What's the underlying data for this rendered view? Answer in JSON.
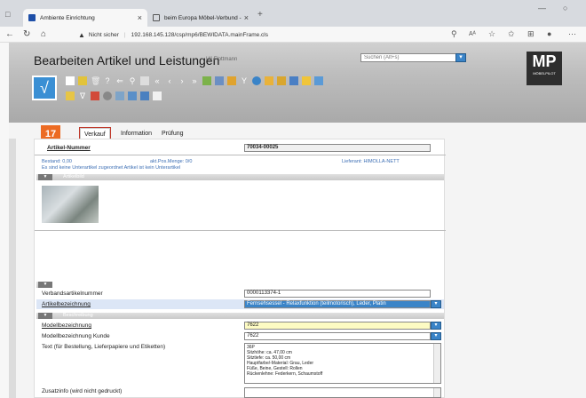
{
  "browser": {
    "tabs": [
      {
        "title": "Ambiente Einrichtung",
        "close": "×"
      },
      {
        "title": "beim Europa Möbel-Verbund -",
        "close": "×"
      }
    ],
    "new_tab": "+",
    "url_warning": "Nicht sicher",
    "url": "192.168.145.128/csp/mp6/BEWIDATA.mainFrame.cls",
    "minimize": "—",
    "restore": "○"
  },
  "app": {
    "title": "Bearbeiten Artikel und Leistungen",
    "user": "Uli Flottmann",
    "search_placeholder": "Suchen (Alt+s)",
    "logo_text": "MP",
    "logo_sub": "MÖBELPILOT",
    "check_symbol": "√",
    "badge_number": "17"
  },
  "tabs": {
    "verkauf": "Verkauf",
    "information": "Information",
    "pruefung": "Prüfung"
  },
  "form": {
    "artikel_nummer_label": "Artikel-Nummer",
    "artikel_nummer_value": "70034-00025",
    "bestand": "Bestand: 0,00",
    "akt_pos_menge": "akt.Pos.Menge: 0/0",
    "lieferant": "Lieferant: HIMOLLA-NETT",
    "unterartikel_info": "Es sind keine Unterartikel zugeordnet     Artikel ist kein Unterartikel",
    "section_artikelbild": "Artikelbild",
    "verbandsartikelnummer_label": "Verbandsartikelnummer",
    "verbandsartikelnummer_value": "0000113374-1",
    "artikelbezeichnung_label": "Artikelbezeichnung",
    "artikelbezeichnung_value": "Fernsehsessel - Relaxfunktion (teilmotorisch), Leder, Platin",
    "section_beschreibung": "Beschreibung",
    "modellbezeichnung_label": "Modellbezeichnung",
    "modellbezeichnung_value": "7622",
    "modellbezeichnung_kunde_label": "Modellbezeichnung Kunde",
    "modellbezeichnung_kunde_value": "7622",
    "text_label": "Text (für Bestellung, Lieferpapiere und Etiketten)",
    "text_lines": [
      "36P",
      "Sitzhöhe: ca. 47,00 cm",
      "Sitztiefe: ca. 50,00 cm",
      "Hauptfarbe/-Material: Grau, Leder",
      "Füße, Beine, Gestell: Rollen",
      "Rückenlehne: Federkern, Schaumstoff"
    ],
    "zusatzinfo_label": "Zusatzinfo (wird nicht gedruckt)"
  },
  "colors": {
    "accent_blue": "#3a84c8",
    "badge_orange": "#ec6b23",
    "highlight_red": "#c0392b",
    "field_yellow": "#fdfbc3"
  }
}
